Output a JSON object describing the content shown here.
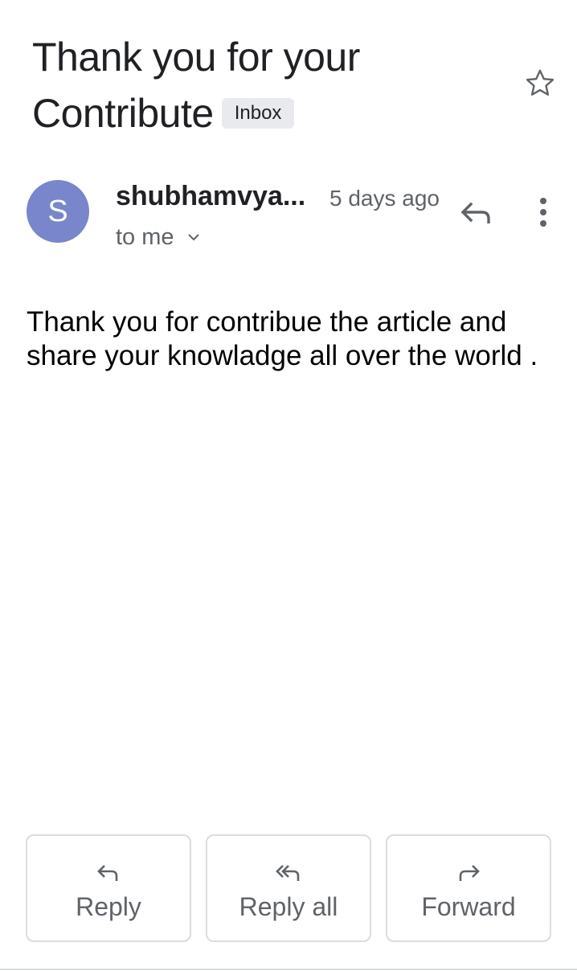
{
  "email": {
    "subject": "Thank you for your Contribute",
    "label": "Inbox",
    "sender": {
      "avatar_letter": "S",
      "avatar_color": "#7986cb",
      "name": "shubhamvya...",
      "date": "5 days ago",
      "recipient": "to me"
    },
    "body": "Thank you for contribue the article and share your knowladge all over the world ."
  },
  "icons": {
    "star": "star-outline-icon",
    "reply": "reply-icon",
    "more": "more-vertical-icon",
    "expand": "chevron-down-icon"
  },
  "actions": {
    "reply_label": "Reply",
    "reply_all_label": "Reply all",
    "forward_label": "Forward"
  }
}
